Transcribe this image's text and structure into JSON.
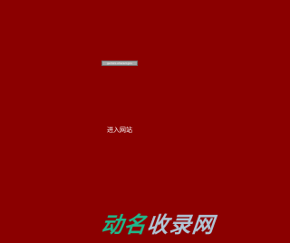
{
  "banner": {
    "text": "gemini-shared.gov"
  },
  "enter_link": {
    "label": "进入网站"
  },
  "watermark": {
    "part_a": "动名",
    "part_b": "收录网"
  },
  "colors": {
    "page_background": "#8b0000",
    "watermark_green": "#1fb78a",
    "watermark_grey": "#b0c4d4"
  }
}
